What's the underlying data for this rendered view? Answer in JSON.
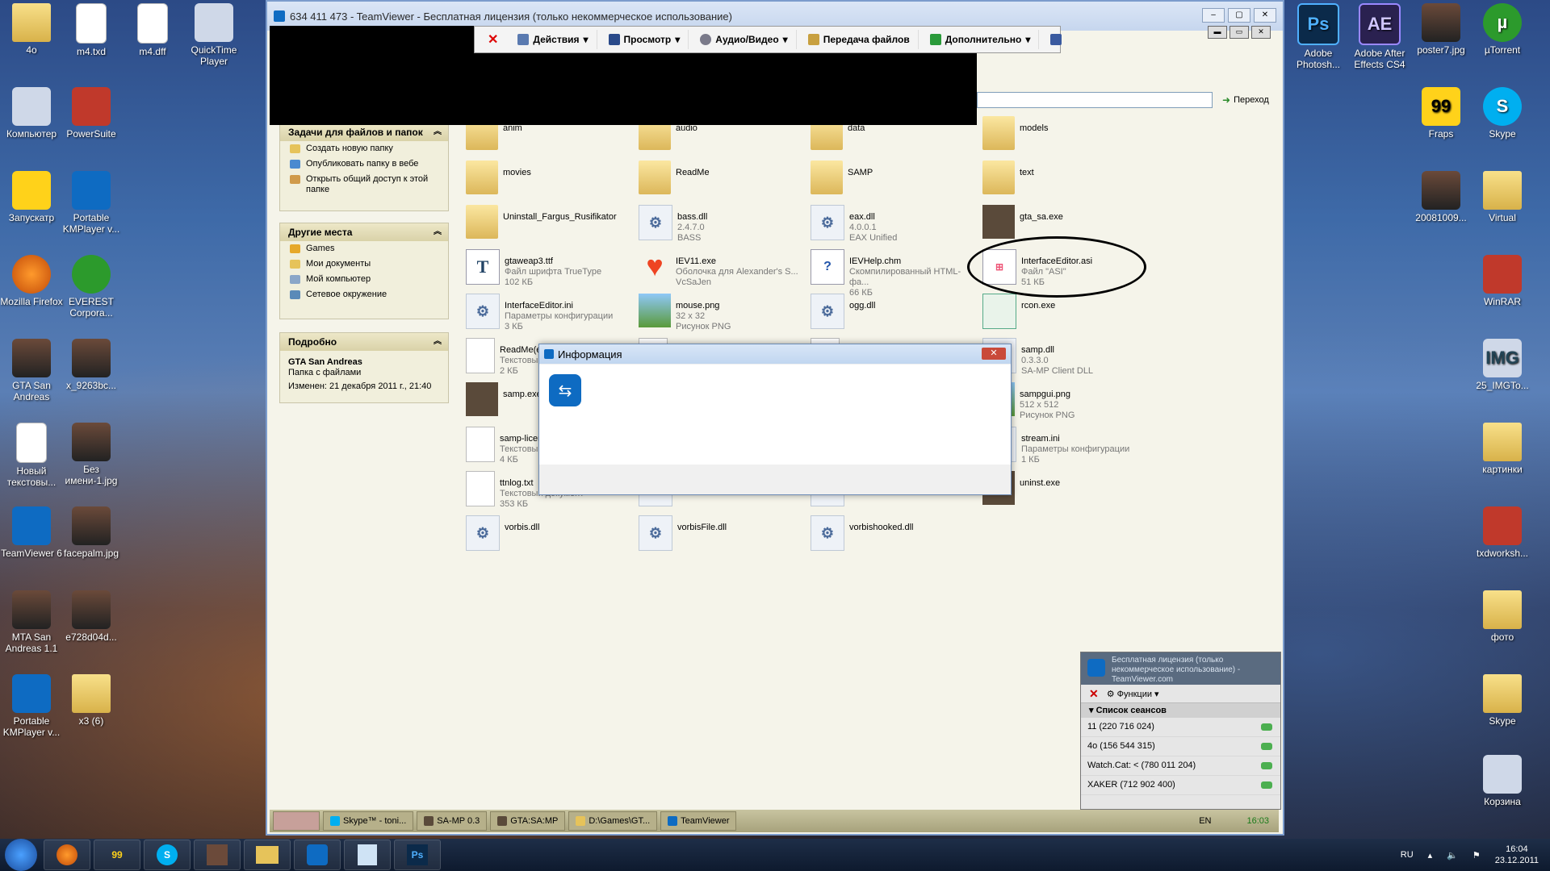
{
  "desktop_left": [
    {
      "label": "4o",
      "type": "folder"
    },
    {
      "label": "m4.txd",
      "type": "doc"
    },
    {
      "label": "m4.dff",
      "type": "doc"
    },
    {
      "label": "QuickTime Player",
      "type": "pc"
    },
    {
      "label": "Компьютер",
      "type": "pc"
    },
    {
      "label": "PowerSuite",
      "type": "red"
    },
    {
      "label": "Запускатр",
      "type": "yellow"
    },
    {
      "label": "Portable KMPlayer v...",
      "type": "tv"
    },
    {
      "label": "Mozilla Firefox",
      "type": "fox"
    },
    {
      "label": "EVEREST Corpora...",
      "type": "green"
    },
    {
      "label": "GTA San Andreas",
      "type": "pic"
    },
    {
      "label": "x_9263bc...",
      "type": "pic"
    },
    {
      "label": "Новый текстовы...",
      "type": "doc"
    },
    {
      "label": "Без имени-1.jpg",
      "type": "pic"
    },
    {
      "label": "TeamViewer 6",
      "type": "tv"
    },
    {
      "label": "facepalm.jpg",
      "type": "pic"
    },
    {
      "label": "MTA San Andreas 1.1",
      "type": "pic"
    },
    {
      "label": "e728d04d...",
      "type": "pic"
    },
    {
      "label": "Portable KMPlayer v...",
      "type": "tv"
    },
    {
      "label": "x3 (6)",
      "type": "folder"
    }
  ],
  "desktop_right": [
    {
      "label": "Adobe Photosh...",
      "type": "ps",
      "glyph": "Ps"
    },
    {
      "label": "Adobe After Effects CS4",
      "type": "ae",
      "glyph": "AE"
    },
    {
      "label": "poster7.jpg",
      "type": "pic",
      "glyph": ""
    },
    {
      "label": "µTorrent",
      "type": "green",
      "glyph": "µ"
    },
    {
      "label": "Fraps",
      "type": "yellow",
      "glyph": "99"
    },
    {
      "label": "Skype",
      "type": "skype",
      "glyph": "S"
    },
    {
      "label": "20081009...",
      "type": "pic",
      "glyph": ""
    },
    {
      "label": "Virtual",
      "type": "folder",
      "glyph": ""
    },
    {
      "label": "WinRAR",
      "type": "red",
      "glyph": ""
    },
    {
      "label": "25_IMGTo...",
      "type": "pc",
      "glyph": "IMG"
    },
    {
      "label": "картинки",
      "type": "folder",
      "glyph": ""
    },
    {
      "label": "txdworksh...",
      "type": "red",
      "glyph": ""
    },
    {
      "label": "фото",
      "type": "folder",
      "glyph": ""
    },
    {
      "label": "Skype",
      "type": "folder",
      "glyph": ""
    },
    {
      "label": "Корзина",
      "type": "pc",
      "glyph": ""
    }
  ],
  "window": {
    "title": "634 411 473 - TeamViewer - Бесплатная лицензия (только некоммерческое использование)",
    "btn_min": "‒",
    "btn_max": "▢",
    "btn_close": "✕"
  },
  "toolbar": {
    "close": "✕",
    "actions": "Действия",
    "view": "Просмотр",
    "audio_video": "Аудио/Видео",
    "file_transfer": "Передача файлов",
    "extra": "Дополнительно"
  },
  "address": {
    "go": "Переход"
  },
  "tasks_panel": {
    "title": "Задачи для файлов и папок",
    "items": [
      "Создать новую папку",
      "Опубликовать папку в вебе",
      "Открыть общий доступ к этой папке"
    ]
  },
  "places_panel": {
    "title": "Другие места",
    "items": [
      "Games",
      "Мои документы",
      "Мой компьютер",
      "Сетевое окружение"
    ]
  },
  "details_panel": {
    "title": "Подробно",
    "name": "GTA San Andreas",
    "type": "Папка с файлами",
    "modified": "Изменен: 21 декабря 2011 г., 21:40"
  },
  "files": [
    {
      "n": "anim",
      "s1": "",
      "s2": "",
      "t": "folder"
    },
    {
      "n": "audio",
      "s1": "",
      "s2": "",
      "t": "folder"
    },
    {
      "n": "data",
      "s1": "",
      "s2": "",
      "t": "folder"
    },
    {
      "n": "models",
      "s1": "",
      "s2": "",
      "t": "folder"
    },
    {
      "n": "movies",
      "s1": "",
      "s2": "",
      "t": "folder"
    },
    {
      "n": "ReadMe",
      "s1": "",
      "s2": "",
      "t": "folder"
    },
    {
      "n": "SAMP",
      "s1": "",
      "s2": "",
      "t": "folder"
    },
    {
      "n": "text",
      "s1": "",
      "s2": "",
      "t": "folder"
    },
    {
      "n": "Uninstall_Fargus_Rusifikator",
      "s1": "",
      "s2": "",
      "t": "folder"
    },
    {
      "n": "bass.dll",
      "s1": "2.4.7.0",
      "s2": "BASS",
      "t": "dll"
    },
    {
      "n": "eax.dll",
      "s1": "4.0.0.1",
      "s2": "EAX Unified",
      "t": "dll"
    },
    {
      "n": "gta_sa.exe",
      "s1": "",
      "s2": "",
      "t": "exe"
    },
    {
      "n": "gtaweap3.ttf",
      "s1": "Файл шрифта TrueType",
      "s2": "102 КБ",
      "t": "font"
    },
    {
      "n": "IEV11.exe",
      "s1": "Оболочка для Alexander's S...",
      "s2": "VcSaJen",
      "t": "heart"
    },
    {
      "n": "IEVHelp.chm",
      "s1": "Скомпилированный HTML-фа...",
      "s2": "66 КБ",
      "t": "chm"
    },
    {
      "n": "InterfaceEditor.asi",
      "s1": "Файл \"ASI\"",
      "s2": "51 КБ",
      "t": "asi"
    },
    {
      "n": "InterfaceEditor.ini",
      "s1": "Параметры конфигурации",
      "s2": "3 КБ",
      "t": "dll"
    },
    {
      "n": "mouse.png",
      "s1": "32 x 32",
      "s2": "Рисунок PNG",
      "t": "img"
    },
    {
      "n": "ogg.dll",
      "s1": "",
      "s2": "",
      "t": "dll"
    },
    {
      "n": "rcon.exe",
      "s1": "",
      "s2": "",
      "t": "rcon"
    },
    {
      "n": "ReadMe(eng).txt",
      "s1": "Текстовый документ",
      "s2": "2 КБ",
      "t": "doc"
    },
    {
      "n": "",
      "s1": "",
      "s2": "",
      "t": "doc"
    },
    {
      "n": "",
      "s1": "",
      "s2": "",
      "t": "doc"
    },
    {
      "n": "samp.dll",
      "s1": "0.3.3.0",
      "s2": "SA-MP Client DLL",
      "t": "dll"
    },
    {
      "n": "samp.exe",
      "s1": "",
      "s2": "",
      "t": "exe"
    },
    {
      "n": "",
      "s1": "",
      "s2": "",
      "t": "none"
    },
    {
      "n": "",
      "s1": "",
      "s2": "",
      "t": "none"
    },
    {
      "n": "sampgui.png",
      "s1": "512 x 512",
      "s2": "Рисунок PNG",
      "t": "img"
    },
    {
      "n": "samp-license.txt",
      "s1": "Текстовый документ",
      "s2": "4 КБ",
      "t": "doc"
    },
    {
      "n": "",
      "s1": "",
      "s2": "",
      "t": "none"
    },
    {
      "n": "",
      "s1": "",
      "s2": "",
      "t": "none"
    },
    {
      "n": "stream.ini",
      "s1": "Параметры конфигурации",
      "s2": "1 КБ",
      "t": "dll"
    },
    {
      "n": "ttnlog.txt",
      "s1": "Текстовый документ",
      "s2": "353 КБ",
      "t": "doc"
    },
    {
      "n": "",
      "s1": "",
      "s2": "8 КБ",
      "t": "dll"
    },
    {
      "n": "",
      "s1": "",
      "s2": "",
      "t": "dll"
    },
    {
      "n": "uninst.exe",
      "s1": "",
      "s2": "",
      "t": "exe"
    },
    {
      "n": "vorbis.dll",
      "s1": "",
      "s2": "",
      "t": "dll"
    },
    {
      "n": "vorbisFile.dll",
      "s1": "",
      "s2": "",
      "t": "dll"
    },
    {
      "n": "vorbishooked.dll",
      "s1": "",
      "s2": "",
      "t": "dll"
    }
  ],
  "dialog": {
    "title": "Информация",
    "close": "✕"
  },
  "inner_taskbar": {
    "items": [
      "Skype™ - toni...",
      "SA-MP 0.3",
      "GTA:SA:MP",
      "D:\\Games\\GT...",
      "TeamViewer"
    ],
    "lang": "EN",
    "time": "16:03"
  },
  "tv_panel": {
    "license": "Бесплатная лицензия (только некоммерческое использование) - TeamViewer.com",
    "functions": "Функции",
    "sessions_title": "Список сеансов",
    "sessions": [
      "11 (220 716 024)",
      "4o (156 544 315)",
      "Watch.Cat: < (780 011 204)",
      "XAKER (712 902 400)"
    ]
  },
  "taskbar": {
    "lang": "RU",
    "time": "16:04",
    "date": "23.12.2011",
    "pinned": [
      "firefox",
      "fraps",
      "skype",
      "gta",
      "explorer",
      "teamviewer",
      "notepad",
      "photoshop"
    ]
  },
  "colors": {
    "accent": "#0e6bc2",
    "circle": "#000000"
  }
}
